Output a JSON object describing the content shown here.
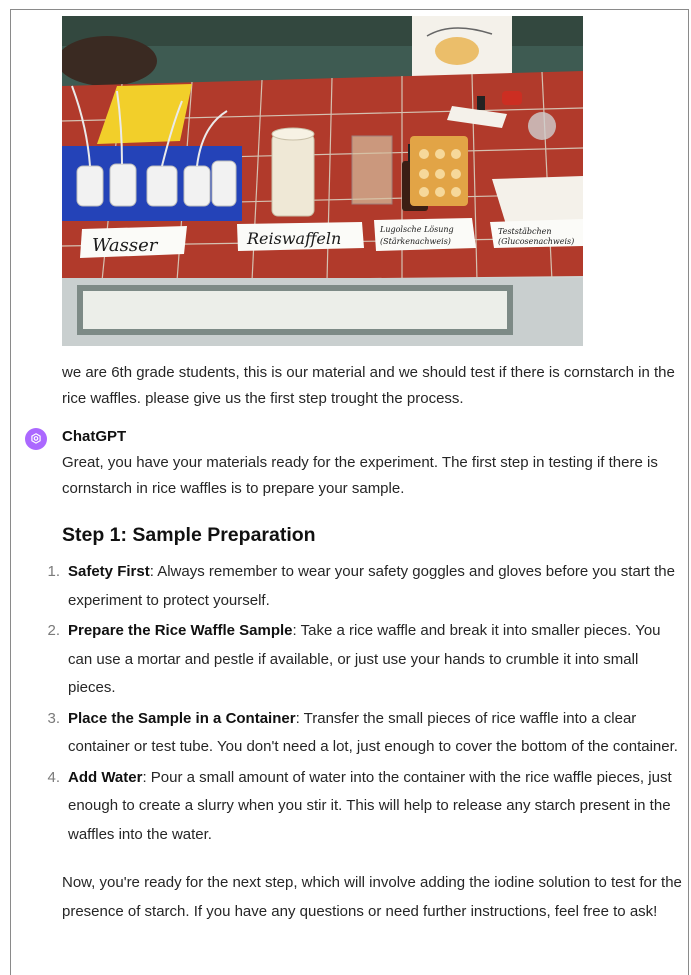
{
  "photo": {
    "alt": "Lab table with materials",
    "labels": {
      "wasser": "Wasser",
      "reiswaffeln": "Reiswaffeln",
      "lugol_line1": "Lugolsche Lösung",
      "lugol_line2": "(Stärkenachweis)",
      "test_line1": "Teststäbchen",
      "test_line2": "(Glucosenachweis)"
    }
  },
  "user_message": "we are 6th grade students, this is our material and we should test if there is cornstarch in the rice waffles. please give us the first step trought the process.",
  "assistant": {
    "name": "ChatGPT",
    "avatar_icon": "openai-logo-icon",
    "avatar_color": "#ab68ff",
    "intro": "Great, you have your materials ready for the experiment. The first step in testing if there is cornstarch in rice waffles is to prepare your sample.",
    "heading": "Step 1: Sample Preparation",
    "steps": [
      {
        "num": "1.",
        "term": "Safety First",
        "text": ": Always remember to wear your safety goggles and gloves before you start the experiment to protect yourself."
      },
      {
        "num": "2.",
        "term": "Prepare the Rice Waffle Sample",
        "text": ": Take a rice waffle and break it into smaller pieces. You can use a mortar and pestle if available, or just use your hands to crumble it into small pieces."
      },
      {
        "num": "3.",
        "term": "Place the Sample in a Container",
        "text": ": Transfer the small pieces of rice waffle into a clear container or test tube. You don't need a lot, just enough to cover the bottom of the container."
      },
      {
        "num": "4.",
        "term": "Add Water",
        "text": ": Pour a small amount of water into the container with the rice waffle pieces, just enough to create a slurry when you stir it. This will help to release any starch present in the waffles into the water."
      }
    ],
    "outro": "Now, you're ready for the next step, which will involve adding the iodine solution to test for the presence of starch. If you have any questions or need further instructions, feel free to ask!"
  }
}
